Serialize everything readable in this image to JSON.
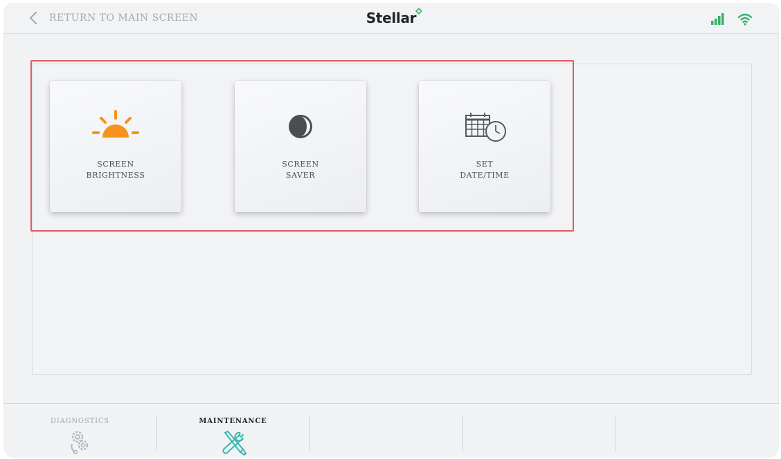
{
  "header": {
    "back_label": "RETURN TO MAIN SCREEN",
    "brand": "Stellar",
    "brand_accent": "#3fb66a",
    "status_icon_color": "#32b36a"
  },
  "tiles": [
    {
      "line1": "SCREEN",
      "line2": "BRIGHTNESS",
      "icon": "sun-icon",
      "icon_color": "#f5931d"
    },
    {
      "line1": "SCREEN",
      "line2": "SAVER",
      "icon": "contrast-moon-icon",
      "icon_color": "#4a4d52"
    },
    {
      "line1": "SET",
      "line2": "DATE/TIME",
      "icon": "calendar-clock-icon",
      "icon_color": "#55585d"
    }
  ],
  "highlight_color": "#e05a5f",
  "tabbar": {
    "tabs": [
      {
        "label": "DIAGNOSTICS",
        "icon": "diagnostics-gears-icon",
        "active": false
      },
      {
        "label": "MAINTENANCE",
        "icon": "wrench-screwdriver-icon",
        "active": true,
        "icon_color": "#35b6ad"
      },
      {
        "label": "",
        "active": false
      },
      {
        "label": "",
        "active": false
      },
      {
        "label": "",
        "active": false
      }
    ]
  }
}
